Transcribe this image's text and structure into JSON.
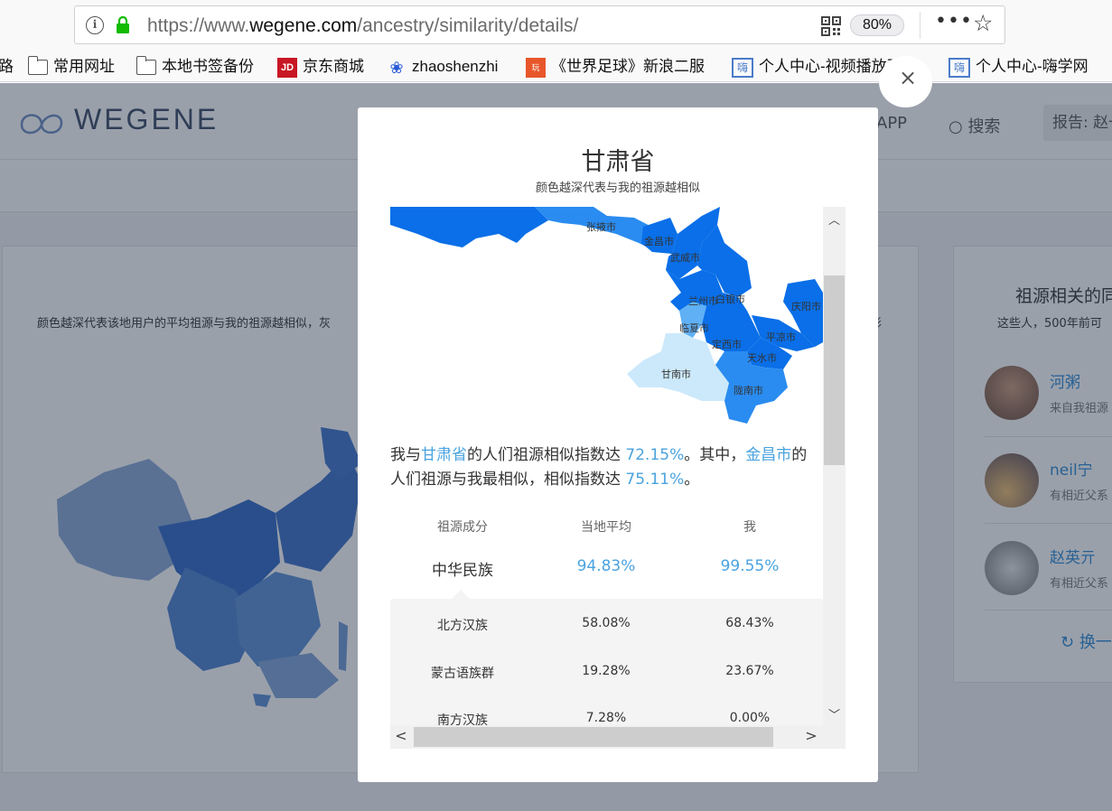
{
  "browser": {
    "url_prefix": "https://www.",
    "url_domain": "wegene.com",
    "url_path": "/ancestry/similarity/details/",
    "zoom": "80%",
    "more": "•••",
    "star": "☆",
    "bookmarks": [
      {
        "label": "路",
        "icon": "none"
      },
      {
        "label": "常用网址",
        "icon": "folder-icon"
      },
      {
        "label": "本地书签备份",
        "icon": "folder-icon"
      },
      {
        "label": "京东商城",
        "icon": "jd-icon"
      },
      {
        "label": "zhaoshenzhi",
        "icon": "baidu-paw-icon"
      },
      {
        "label": "《世界足球》新浪二服",
        "icon": "game-icon"
      },
      {
        "label": "个人中心-视频播放页...",
        "icon": "site-icon"
      },
      {
        "label": "个人中心-嗨学网",
        "icon": "site-icon"
      }
    ],
    "bookmark_icon_text": {
      "jd": "JD",
      "wot": "玩",
      "hh": "嗨",
      "paw": "❀"
    }
  },
  "site": {
    "logo": "WEGENE",
    "nav_app": "APP",
    "nav_search": "搜索",
    "report": "报告: 赵一",
    "left_desc": "颜色越深代表该地用户的平均祖源与我的祖源越相似，灰",
    "left_desc_tail": "影",
    "right_title": "祖源相关的同",
    "right_sub": "这些人，500年前可",
    "users": [
      {
        "name": "河粥",
        "desc": "来自我祖源"
      },
      {
        "name": "neil宁",
        "desc": "有相近父系"
      },
      {
        "name": "赵英亓",
        "desc": "有相近父系"
      }
    ],
    "refresh": "换一"
  },
  "modal": {
    "close": "×",
    "title": "甘肃省",
    "subtitle": "颜色越深代表与我的祖源越相似",
    "summary": {
      "p1": "我与",
      "province": "甘肃省",
      "p2": "的人们祖源相似指数达 ",
      "province_index": "72.15%",
      "p3": "。其中，",
      "city": "金昌市",
      "p4": "的人们祖源与我最相似，相似指数达 ",
      "city_index": "75.11%",
      "p5": "。"
    },
    "map_labels": [
      "张掖市",
      "金昌市",
      "武威市",
      "兰州市",
      "白银市",
      "庆阳市",
      "临夏市",
      "平凉市",
      "定西市",
      "天水市",
      "甘南市",
      "陇南市"
    ],
    "table": {
      "headers": [
        "祖源成分",
        "当地平均",
        "我"
      ],
      "main": {
        "name": "中华民族",
        "avg": "94.83%",
        "me": "99.55%"
      },
      "rows": [
        {
          "name": "北方汉族",
          "avg": "58.08%",
          "me": "68.43%"
        },
        {
          "name": "蒙古语族群",
          "avg": "19.28%",
          "me": "23.67%"
        },
        {
          "name": "南方汉族",
          "avg": "7.28%",
          "me": "0.00%"
        }
      ]
    }
  },
  "colors": {
    "accent": "#4aa3df",
    "map_dark": "#0a6fe8",
    "map_mid": "#2a8cf0",
    "map_light": "#cce9fb"
  }
}
